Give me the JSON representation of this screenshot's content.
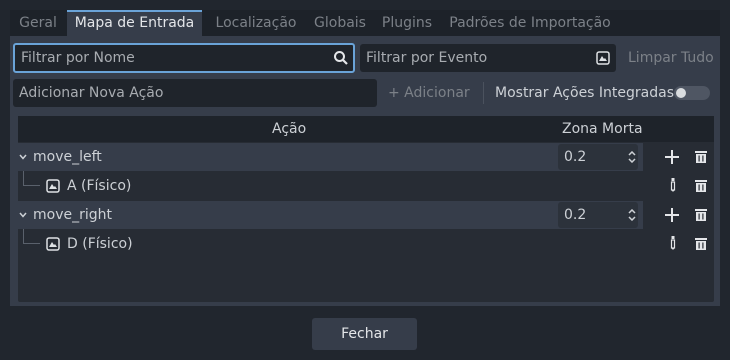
{
  "tabs": [
    {
      "label": "Geral"
    },
    {
      "label": "Mapa de Entrada"
    },
    {
      "label": "Localização"
    },
    {
      "label": "Globais"
    },
    {
      "label": "Plugins"
    },
    {
      "label": "Padrões de Importação"
    }
  ],
  "active_tab": "Mapa de Entrada",
  "filter": {
    "name_placeholder": "Filtrar por Nome",
    "event_placeholder": "Filtrar por Evento",
    "clear_all": "Limpar Tudo"
  },
  "add": {
    "placeholder": "Adicionar Nova Ação",
    "button": "+ Adicionar"
  },
  "builtin_toggle": {
    "label": "Mostrar Ações Integradas",
    "on": false
  },
  "table": {
    "col_action": "Ação",
    "col_deadzone": "Zona Morta",
    "actions": [
      {
        "name": "move_left",
        "deadzone": "0.2",
        "event": "A (Físico)"
      },
      {
        "name": "move_right",
        "deadzone": "0.2",
        "event": "D (Físico)"
      }
    ]
  },
  "footer": {
    "close": "Fechar"
  },
  "colors": {
    "accent": "#6aa3d8",
    "panel": "#363d4a",
    "background": "#21262e"
  }
}
